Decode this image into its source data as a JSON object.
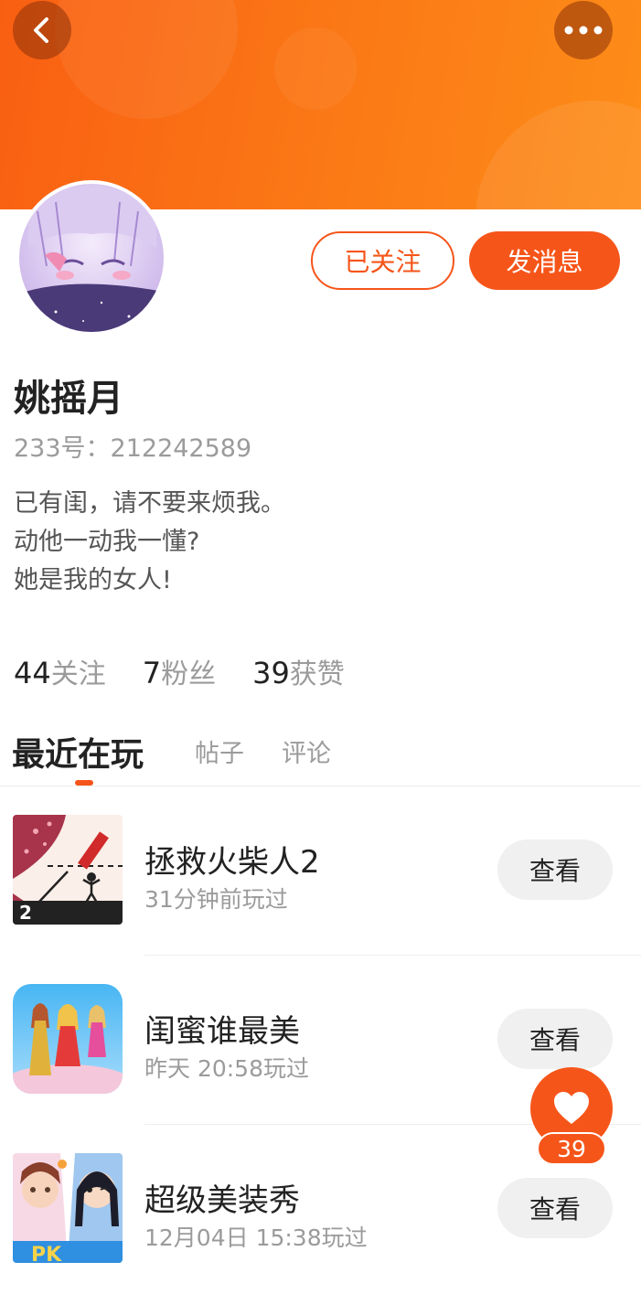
{
  "colors": {
    "accent": "#f6551a",
    "banner_start": "#f95f12",
    "banner_end": "#fd8d18"
  },
  "header": {
    "back_icon": "chevron-left-icon",
    "more_icon": "more-dots-icon"
  },
  "profile": {
    "avatar_icon": "anime-avatar",
    "followed_label": "已关注",
    "message_label": "发消息",
    "name": "姚摇月",
    "uid": "233号：212242589",
    "bio": [
      "已有闺，请不要来烦我。",
      "动他一动我一懂?",
      "她是我的女人!"
    ]
  },
  "stats": [
    {
      "num": "44",
      "label": "关注"
    },
    {
      "num": "7",
      "label": "粉丝"
    },
    {
      "num": "39",
      "label": "获赞"
    }
  ],
  "tabs": [
    {
      "label": "最近在玩"
    },
    {
      "label": "帖子"
    },
    {
      "label": "评论"
    }
  ],
  "games": [
    {
      "title": "拯救火柴人2",
      "time": "31分钟前玩过",
      "button": "查看",
      "icon": "stickman-game-icon"
    },
    {
      "title": "闺蜜谁最美",
      "time": "昨天 20:58玩过",
      "button": "查看",
      "icon": "beauty-contest-game-icon"
    },
    {
      "title": "超级美装秀",
      "time": "12月04日 15:38玩过",
      "button": "查看",
      "icon": "makeup-show-game-icon"
    }
  ],
  "like": {
    "icon": "heart-icon",
    "count": "39"
  }
}
